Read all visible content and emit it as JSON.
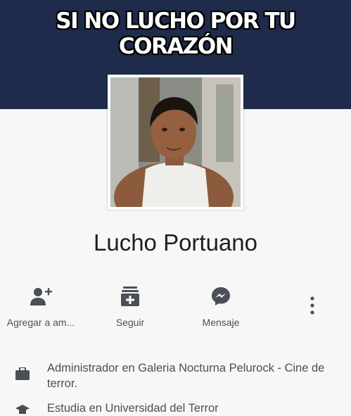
{
  "caption": "SI NO LUCHO POR TU CORAZÓN",
  "profile": {
    "name": "Lucho Portuano"
  },
  "actions": [
    {
      "label": "Agregar a am...",
      "icon": "add-friend-icon"
    },
    {
      "label": "Seguir",
      "icon": "follow-icon"
    },
    {
      "label": "Mensaje",
      "icon": "messenger-icon"
    }
  ],
  "more_icon": "more-options-icon",
  "info": [
    {
      "icon": "briefcase-icon",
      "text": "Administrador en Galeria Nocturna Pelurock - Cine de terror."
    },
    {
      "icon": "graduation-cap-icon",
      "text": "Estudia en Universidad del Terror"
    }
  ],
  "colors": {
    "cover": "#1f2b4a",
    "background": "#f7f7f7",
    "icon": "#4b4f56",
    "name": "#1c1e21"
  }
}
